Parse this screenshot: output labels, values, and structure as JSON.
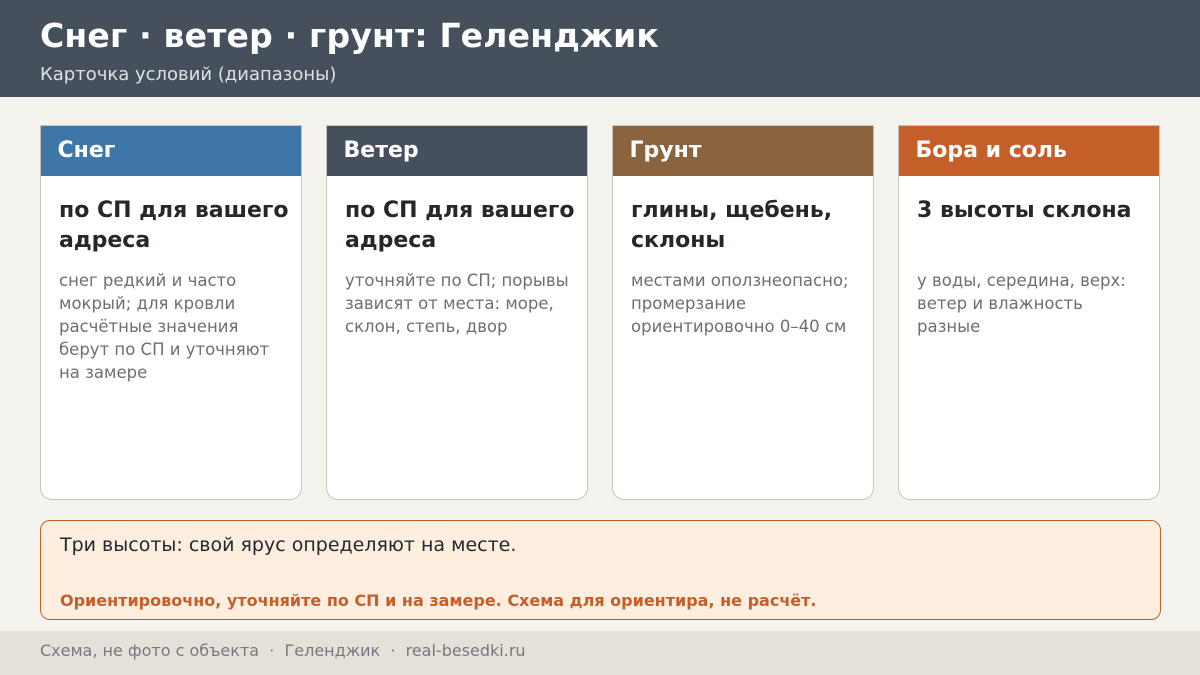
{
  "header": {
    "title": "Снег · ветер · грунт: Геленджик",
    "subtitle": "Карточка условий (диапазоны)"
  },
  "cards": [
    {
      "title": "Снег",
      "value": "по СП для вашего адреса",
      "note": "снег редкий и часто мокрый; для кровли расчётные значения берут по СП и уточняют на замере",
      "color": "#3e76a8"
    },
    {
      "title": "Ветер",
      "value": "по СП для вашего адреса",
      "note": "уточняйте по СП; порывы зависят от места: море, склон, степь, двор",
      "color": "#46505c"
    },
    {
      "title": "Грунт",
      "value": "глины, щебень, склоны",
      "note": "местами оползнеопасно; промерзание ориентировочно 0–40 см",
      "color": "#8a643e"
    },
    {
      "title": "Бора и соль",
      "value": "3 высоты склона",
      "note": "у воды, середина, верх: ветер и влажность разные",
      "color": "#c45f2a"
    }
  ],
  "notice": {
    "main": "Три высоты: свой ярус определяют на месте.",
    "warning": "Ориентировочно, уточняйте по СП и на замере. Схема для ориентира, не расчёт."
  },
  "footer": {
    "text": "Схема, не фото с объекта  ·  Геленджик  ·  real-besedki.ru"
  }
}
